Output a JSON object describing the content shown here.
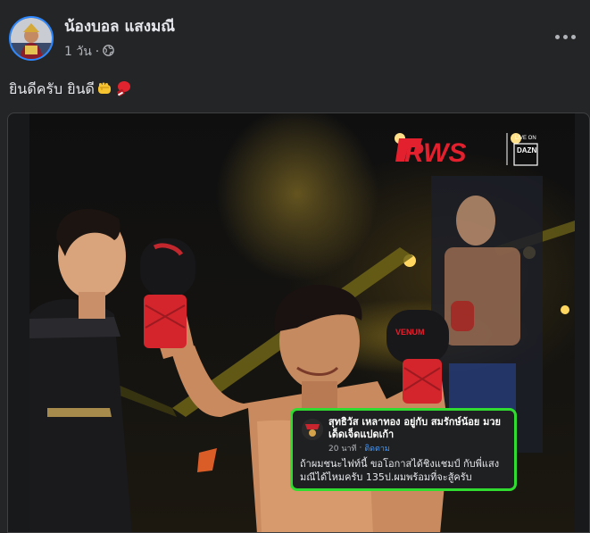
{
  "post": {
    "author": "น้องบอล แสงมณี",
    "time": "1 วัน",
    "separator": "·",
    "audience_icon": "globe-icon",
    "more_icon": "more-options-icon",
    "caption_text": "ยินดีครับ ยินดี",
    "caption_emojis": [
      "fist-emoji",
      "boxing-glove-emoji"
    ]
  },
  "photo": {
    "logo_text": "RWS",
    "live_on": "LIVE ON",
    "broadcaster": "DAZN",
    "glove_brand": "VENUM",
    "comment": {
      "name": "สุทธิวัส เหลาทอง อยู่กับ สมรักษ์น้อย มวยเด็ดเจ็ดแปดเก้า",
      "time": "20 นาที",
      "separator": "·",
      "follow": "ติดตาม",
      "text": "ถ้าผมชนะไฟท์นี้ ขอโอกาสได้ชิงแชมป์ กับพี่แสงมณีได้ไหมครับ 135ป.ผมพร้อมที่จะสู้ครับ",
      "highlight_color": "#2fdc2f"
    }
  },
  "colors": {
    "background": "#242526",
    "text_primary": "#e4e6eb",
    "text_secondary": "#b0b3b8",
    "link": "#4599ff",
    "rws_red": "#e3202e"
  }
}
